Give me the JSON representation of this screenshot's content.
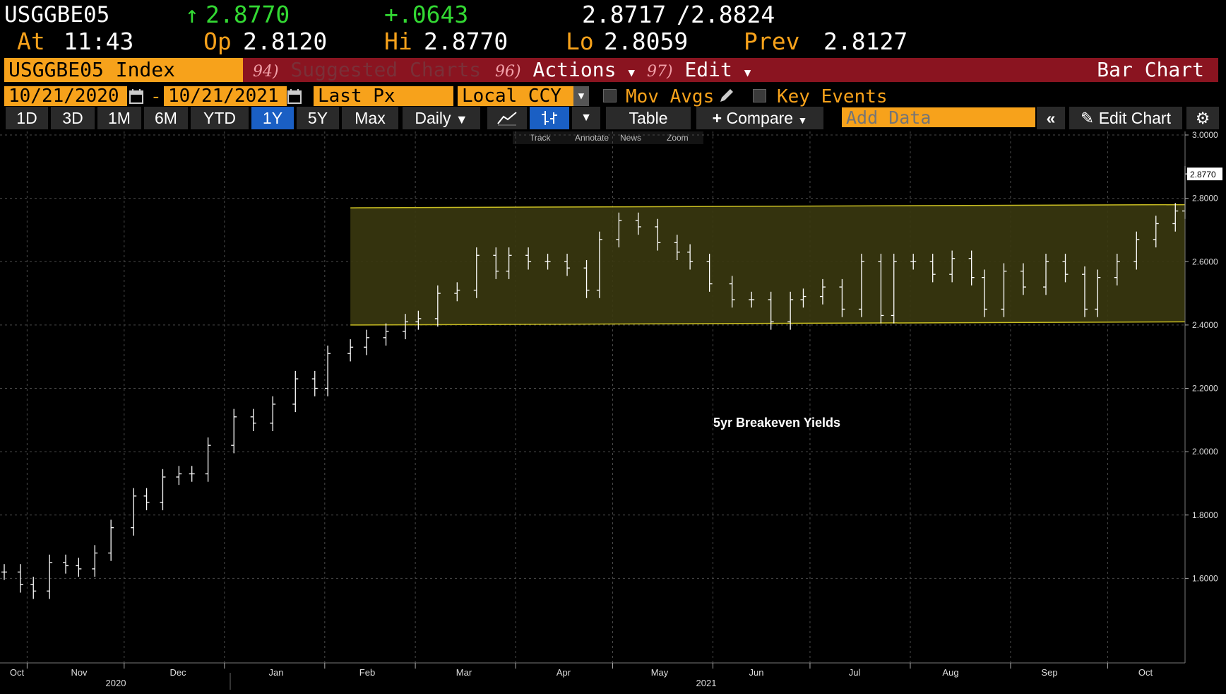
{
  "quote": {
    "ticker": "USGGBE05",
    "arrow": "↑",
    "last": "2.8770",
    "change": "+.0643",
    "bid": "2.8717",
    "sep": "/",
    "ask": "2.8824",
    "at_label": "At",
    "time": "11:43",
    "op_label": "Op",
    "open": "2.8120",
    "hi_label": "Hi",
    "high": "2.8770",
    "lo_label": "Lo",
    "low": "2.8059",
    "prev_label": "Prev",
    "prev": "2.8127"
  },
  "toolbar1": {
    "security": "USGGBE05 Index",
    "suggested_num": "94)",
    "suggested": "Suggested Charts",
    "actions_num": "96)",
    "actions": "Actions",
    "edit_num": "97)",
    "edit": "Edit",
    "chart_type": "Bar Chart"
  },
  "toolbar2": {
    "start_date": "10/21/2020",
    "dash": "-",
    "end_date": "10/21/2021",
    "field": "Last Px",
    "currency": "Local CCY",
    "mov_avgs": "Mov Avgs",
    "key_events": "Key Events"
  },
  "toolbar3": {
    "periods": [
      "1D",
      "3D",
      "1M",
      "6M",
      "YTD",
      "1Y",
      "5Y",
      "Max"
    ],
    "active_period": "1Y",
    "frequency": "Daily",
    "table": "Table",
    "compare": "Compare",
    "add_data_placeholder": "Add Data",
    "edit_chart": "Edit Chart"
  },
  "chart_tools": [
    "Track",
    "Annotate",
    "News",
    "Zoom"
  ],
  "chart_data": {
    "type": "bar",
    "subtype": "ohlc",
    "annotation": "5yr Breakeven Yields",
    "last_label": "2.8770",
    "ylim": [
      1.4,
      3.0
    ],
    "y_ticks": [
      "3.0000",
      "2.8000",
      "2.6000",
      "2.4000",
      "2.2000",
      "2.0000",
      "1.8000",
      "1.6000"
    ],
    "x_months": [
      "Oct",
      "Nov",
      "Dec",
      "Jan",
      "Feb",
      "Mar",
      "Apr",
      "May",
      "Jun",
      "Jul",
      "Aug",
      "Sep",
      "Oct"
    ],
    "x_years": [
      "2020",
      "2021"
    ],
    "grid": true,
    "channel": {
      "color": "#c8bd22",
      "start": "2021-02-05",
      "end": "2021-10-21",
      "upper_start": 2.77,
      "upper_end": 2.78,
      "lower_start": 2.4,
      "lower_end": 2.41
    },
    "series": [
      {
        "dates": [
          "2020-10-21",
          "2020-10-26",
          "2020-10-30",
          "2020-11-04",
          "2020-11-09",
          "2020-11-13",
          "2020-11-18",
          "2020-11-23",
          "2020-11-30",
          "2020-12-04",
          "2020-12-09",
          "2020-12-14",
          "2020-12-18",
          "2020-12-23",
          "2020-12-31",
          "2021-01-06",
          "2021-01-12",
          "2021-01-19",
          "2021-01-25",
          "2021-01-29",
          "2021-02-05",
          "2021-02-10",
          "2021-02-16",
          "2021-02-22",
          "2021-02-26",
          "2021-03-04",
          "2021-03-10",
          "2021-03-16",
          "2021-03-22",
          "2021-03-26",
          "2021-04-01",
          "2021-04-07",
          "2021-04-13",
          "2021-04-19",
          "2021-04-23",
          "2021-04-29",
          "2021-05-05",
          "2021-05-11",
          "2021-05-17",
          "2021-05-21",
          "2021-05-27",
          "2021-06-03",
          "2021-06-09",
          "2021-06-15",
          "2021-06-21",
          "2021-06-25",
          "2021-07-01",
          "2021-07-07",
          "2021-07-13",
          "2021-07-19",
          "2021-07-23",
          "2021-07-29",
          "2021-08-04",
          "2021-08-10",
          "2021-08-16",
          "2021-08-20",
          "2021-08-26",
          "2021-09-01",
          "2021-09-08",
          "2021-09-14",
          "2021-09-20",
          "2021-09-24",
          "2021-09-30",
          "2021-10-06",
          "2021-10-12",
          "2021-10-18",
          "2021-10-21"
        ],
        "values": [
          1.62,
          1.58,
          1.56,
          1.65,
          1.64,
          1.63,
          1.68,
          1.76,
          1.86,
          1.84,
          1.92,
          1.93,
          1.93,
          2.02,
          2.11,
          2.09,
          2.15,
          2.23,
          2.2,
          2.31,
          2.33,
          2.36,
          2.38,
          2.41,
          2.42,
          2.5,
          2.51,
          2.62,
          2.57,
          2.62,
          2.6,
          2.6,
          2.58,
          2.51,
          2.67,
          2.73,
          2.71,
          2.66,
          2.63,
          2.6,
          2.53,
          2.48,
          2.48,
          2.41,
          2.48,
          2.49,
          2.52,
          2.45,
          2.6,
          2.43,
          2.6,
          2.6,
          2.56,
          2.61,
          2.55,
          2.45,
          2.57,
          2.52,
          2.6,
          2.56,
          2.45,
          2.55,
          2.6,
          2.67,
          2.72,
          2.76,
          2.877
        ]
      }
    ]
  }
}
